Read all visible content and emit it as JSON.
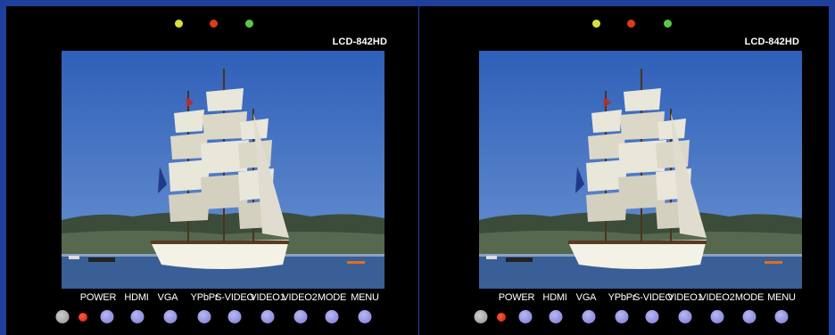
{
  "monitors": [
    {
      "model": "LCD-842HD",
      "leds": [
        {
          "name": "yellow",
          "color": "#d8e040"
        },
        {
          "name": "red",
          "color": "#e03a1c"
        },
        {
          "name": "green",
          "color": "#58c848"
        }
      ],
      "buttons": [
        {
          "label": "POWER"
        },
        {
          "label": ""
        },
        {
          "label": "HDMI"
        },
        {
          "label": "VGA"
        },
        {
          "label": "YPbPr"
        },
        {
          "label": "S-VIDEO"
        },
        {
          "label": "VIDEO1"
        },
        {
          "label": "VIDEO2"
        },
        {
          "label": "MODE"
        },
        {
          "label": "MENU"
        }
      ]
    },
    {
      "model": "LCD-842HD",
      "leds": [
        {
          "name": "yellow",
          "color": "#d8e040"
        },
        {
          "name": "red",
          "color": "#e03a1c"
        },
        {
          "name": "green",
          "color": "#58c848"
        }
      ],
      "buttons": [
        {
          "label": "POWER"
        },
        {
          "label": ""
        },
        {
          "label": "HDMI"
        },
        {
          "label": "VGA"
        },
        {
          "label": "YPbPr"
        },
        {
          "label": "S-VIDEO"
        },
        {
          "label": "VIDEO1"
        },
        {
          "label": "VIDEO2"
        },
        {
          "label": "MODE"
        },
        {
          "label": "MENU"
        }
      ]
    }
  ],
  "colors": {
    "background": "#1f3f9a",
    "bezel": "#000000",
    "sky": "#4f7bc6",
    "water": "#3a5e96"
  }
}
